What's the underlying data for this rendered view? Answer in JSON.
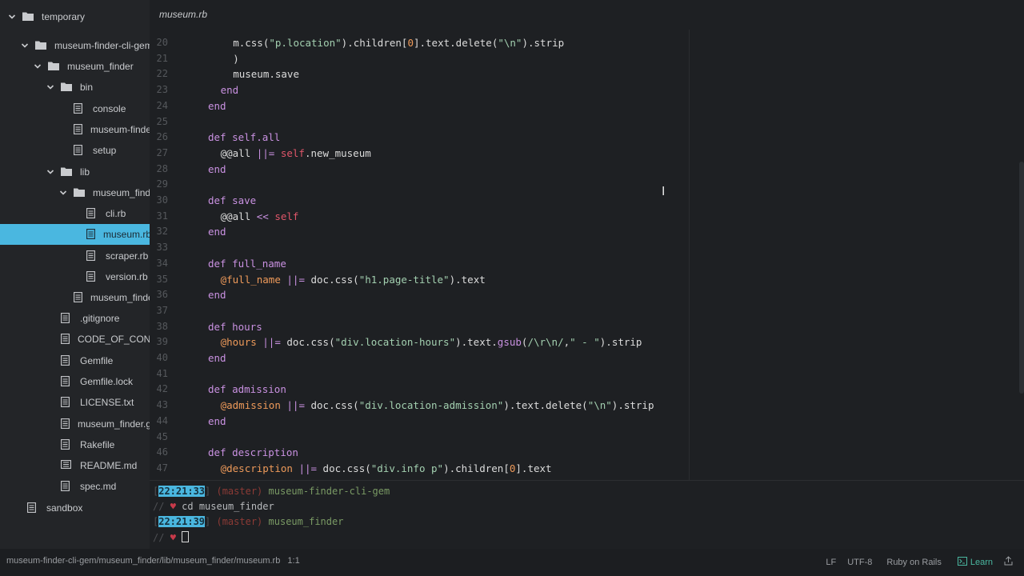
{
  "sidebar": {
    "items": [
      {
        "label": "temporary",
        "kind": "folder",
        "expanded": true,
        "depth": 0
      },
      {
        "label": "museum-finder-cli-gem",
        "kind": "folder",
        "expanded": true,
        "depth": 1
      },
      {
        "label": "museum_finder",
        "kind": "folder",
        "expanded": true,
        "depth": 2
      },
      {
        "label": "bin",
        "kind": "folder",
        "expanded": true,
        "depth": 3
      },
      {
        "label": "console",
        "kind": "file",
        "depth": 4
      },
      {
        "label": "museum-finder",
        "kind": "file",
        "depth": 4
      },
      {
        "label": "setup",
        "kind": "file",
        "depth": 4
      },
      {
        "label": "lib",
        "kind": "folder",
        "expanded": true,
        "depth": 3
      },
      {
        "label": "museum_finder",
        "kind": "folder",
        "expanded": true,
        "depth": 4
      },
      {
        "label": "cli.rb",
        "kind": "file",
        "depth": 5
      },
      {
        "label": "museum.rb",
        "kind": "file",
        "depth": 5,
        "selected": true
      },
      {
        "label": "scraper.rb",
        "kind": "file",
        "depth": 5
      },
      {
        "label": "version.rb",
        "kind": "file",
        "depth": 5
      },
      {
        "label": "museum_finder",
        "kind": "file",
        "depth": 4
      },
      {
        "label": ".gitignore",
        "kind": "file",
        "depth": 3
      },
      {
        "label": "CODE_OF_COND",
        "kind": "file",
        "depth": 3
      },
      {
        "label": "Gemfile",
        "kind": "file",
        "depth": 3
      },
      {
        "label": "Gemfile.lock",
        "kind": "file",
        "depth": 3
      },
      {
        "label": "LICENSE.txt",
        "kind": "file",
        "depth": 3
      },
      {
        "label": "museum_finder.ge",
        "kind": "file",
        "depth": 3
      },
      {
        "label": "Rakefile",
        "kind": "file",
        "depth": 3
      },
      {
        "label": "README.md",
        "kind": "markdown",
        "depth": 3
      },
      {
        "label": "spec.md",
        "kind": "file",
        "depth": 3
      },
      {
        "label": "sandbox",
        "kind": "file",
        "depth": 2
      }
    ]
  },
  "tabs": [
    {
      "label": "museum.rb",
      "active": true
    }
  ],
  "editor": {
    "lines": [
      {
        "n": "20",
        "indent": 3,
        "tokens": [
          [
            "plain",
            "m.css("
          ],
          [
            "str",
            "\"p.location\""
          ],
          [
            "plain",
            ").children["
          ],
          [
            "num",
            "0"
          ],
          [
            "plain",
            "].text.delete("
          ],
          [
            "str",
            "\"\\n\""
          ],
          [
            "plain",
            ").strip"
          ]
        ]
      },
      {
        "n": "21",
        "indent": 3,
        "tokens": [
          [
            "plain",
            ")"
          ]
        ]
      },
      {
        "n": "22",
        "indent": 3,
        "tokens": [
          [
            "plain",
            "museum.save"
          ]
        ]
      },
      {
        "n": "23",
        "indent": 2,
        "tokens": [
          [
            "kw",
            "end"
          ]
        ]
      },
      {
        "n": "24",
        "indent": 1,
        "tokens": [
          [
            "kw",
            "end"
          ]
        ]
      },
      {
        "n": "25",
        "indent": 0,
        "tokens": []
      },
      {
        "n": "26",
        "indent": 1,
        "tokens": [
          [
            "kw",
            "def "
          ],
          [
            "fn",
            "self.all"
          ]
        ]
      },
      {
        "n": "27",
        "indent": 2,
        "tokens": [
          [
            "plain",
            "@@all "
          ],
          [
            "kw",
            "||="
          ],
          [
            "plain",
            " "
          ],
          [
            "self",
            "self"
          ],
          [
            "plain",
            ".new_museum"
          ]
        ]
      },
      {
        "n": "28",
        "indent": 1,
        "tokens": [
          [
            "kw",
            "end"
          ]
        ]
      },
      {
        "n": "29",
        "indent": 0,
        "tokens": []
      },
      {
        "n": "30",
        "indent": 1,
        "tokens": [
          [
            "kw",
            "def "
          ],
          [
            "fn",
            "save"
          ]
        ]
      },
      {
        "n": "31",
        "indent": 2,
        "tokens": [
          [
            "plain",
            "@@all "
          ],
          [
            "kw",
            "<<"
          ],
          [
            "plain",
            " "
          ],
          [
            "self",
            "self"
          ]
        ]
      },
      {
        "n": "32",
        "indent": 1,
        "tokens": [
          [
            "kw",
            "end"
          ]
        ]
      },
      {
        "n": "33",
        "indent": 0,
        "tokens": []
      },
      {
        "n": "34",
        "indent": 1,
        "tokens": [
          [
            "kw",
            "def "
          ],
          [
            "fn",
            "full_name"
          ]
        ]
      },
      {
        "n": "35",
        "indent": 2,
        "tokens": [
          [
            "ivar",
            "@full_name"
          ],
          [
            "plain",
            " "
          ],
          [
            "kw",
            "||="
          ],
          [
            "plain",
            " doc.css("
          ],
          [
            "str",
            "\"h1.page-title\""
          ],
          [
            "plain",
            ").text"
          ]
        ]
      },
      {
        "n": "36",
        "indent": 1,
        "tokens": [
          [
            "kw",
            "end"
          ]
        ]
      },
      {
        "n": "37",
        "indent": 0,
        "tokens": []
      },
      {
        "n": "38",
        "indent": 1,
        "tokens": [
          [
            "kw",
            "def "
          ],
          [
            "fn",
            "hours"
          ]
        ]
      },
      {
        "n": "39",
        "indent": 2,
        "tokens": [
          [
            "ivar",
            "@hours"
          ],
          [
            "plain",
            " "
          ],
          [
            "kw",
            "||="
          ],
          [
            "plain",
            " doc.css("
          ],
          [
            "str",
            "\"div.location-hours\""
          ],
          [
            "plain",
            ").text."
          ],
          [
            "fn",
            "gsub"
          ],
          [
            "plain",
            "("
          ],
          [
            "str",
            "/\\r\\n/"
          ],
          [
            "plain",
            ","
          ],
          [
            "str",
            "\" - \""
          ],
          [
            "plain",
            ").strip"
          ]
        ]
      },
      {
        "n": "40",
        "indent": 1,
        "tokens": [
          [
            "kw",
            "end"
          ]
        ]
      },
      {
        "n": "41",
        "indent": 0,
        "tokens": []
      },
      {
        "n": "42",
        "indent": 1,
        "tokens": [
          [
            "kw",
            "def "
          ],
          [
            "fn",
            "admission"
          ]
        ]
      },
      {
        "n": "43",
        "indent": 2,
        "tokens": [
          [
            "ivar",
            "@admission"
          ],
          [
            "plain",
            " "
          ],
          [
            "kw",
            "||="
          ],
          [
            "plain",
            " doc.css("
          ],
          [
            "str",
            "\"div.location-admission\""
          ],
          [
            "plain",
            ").text.delete("
          ],
          [
            "str",
            "\"\\n\""
          ],
          [
            "plain",
            ").strip"
          ]
        ]
      },
      {
        "n": "44",
        "indent": 1,
        "tokens": [
          [
            "kw",
            "end"
          ]
        ]
      },
      {
        "n": "45",
        "indent": 0,
        "tokens": []
      },
      {
        "n": "46",
        "indent": 1,
        "tokens": [
          [
            "kw",
            "def "
          ],
          [
            "fn",
            "description"
          ]
        ]
      },
      {
        "n": "47",
        "indent": 2,
        "tokens": [
          [
            "ivar",
            "@description"
          ],
          [
            "plain",
            " "
          ],
          [
            "kw",
            "||="
          ],
          [
            "plain",
            " doc.css("
          ],
          [
            "str",
            "\"div.info p\""
          ],
          [
            "plain",
            ").children["
          ],
          [
            "num",
            "0"
          ],
          [
            "plain",
            "].text"
          ]
        ]
      }
    ]
  },
  "terminal": {
    "lines": [
      {
        "time": "22:21:33",
        "branch": "(master)",
        "path": "museum-finder-cli-gem"
      },
      {
        "command": "cd museum_finder"
      },
      {
        "time": "22:21:39",
        "branch": "(master)",
        "path": "museum_finder"
      },
      {
        "command": ""
      }
    ],
    "prompt_slashes": "//",
    "prompt_heart": "♥"
  },
  "status": {
    "path": "museum-finder-cli-gem/museum_finder/lib/museum_finder/museum.rb",
    "position": "1:1",
    "line_ending": "LF",
    "encoding": "UTF-8",
    "grammar": "Ruby on Rails",
    "learn": "Learn"
  },
  "colors": {
    "accent": "#4ab7e0",
    "background": "#1e2023"
  },
  "icons": [
    "chevron-down-icon",
    "folder-icon",
    "file-icon",
    "markdown-file-icon",
    "terminal-icon",
    "upload-icon"
  ]
}
